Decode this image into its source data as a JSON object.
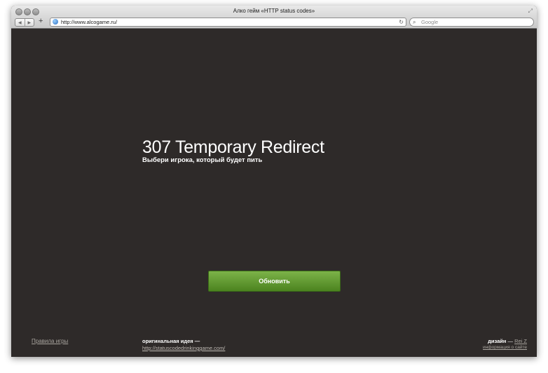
{
  "browser": {
    "window_title": "Алко гейм «HTTP status codes»",
    "url": "http://www.alcogame.ru/",
    "search_placeholder": "Google",
    "back_glyph": "◀",
    "forward_glyph": "▶",
    "add_glyph": "+",
    "reload_glyph": "↻",
    "resize_glyph": "⤢",
    "icons": [
      "back-icon",
      "forward-icon",
      "add-icon",
      "globe-icon",
      "reload-icon",
      "search-icon",
      "resize-icon"
    ]
  },
  "page": {
    "status_title": "307 Temporary Redirect",
    "subtitle": "Выбери игрока, который будет пить",
    "refresh_button": "Обновить",
    "footer": {
      "rules_link": "Правила игры",
      "original_idea_label": "оригинальная идея —",
      "original_idea_link": "http://statuscodedrinkinggame.com/",
      "design_label": "дизайн",
      "design_separator": " — ",
      "design_author": "Rei Z",
      "site_info_link": "информация о сайте"
    }
  },
  "colors": {
    "page_background": "#2e2a29",
    "button_green": "#5f9a2f",
    "text_white": "#ffffff",
    "muted_link": "#a9a59f"
  }
}
